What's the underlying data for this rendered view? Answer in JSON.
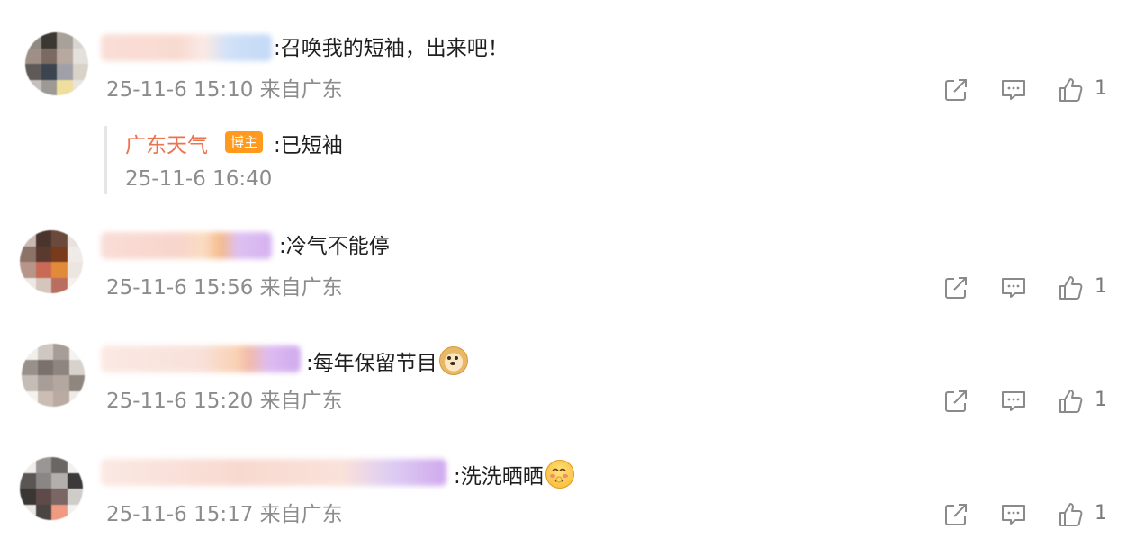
{
  "comments": [
    {
      "text": ":召唤我的短袖，出来吧！",
      "time": "25-11-6 15:10 来自广东",
      "likes": "1",
      "reply": {
        "author": "广东天气",
        "badge": "博主",
        "text": ":已短袖",
        "time": "25-11-6 16:40"
      }
    },
    {
      "text": ":冷气不能停",
      "time": "25-11-6 15:56 来自广东",
      "likes": "1"
    },
    {
      "text": ":每年保留节目",
      "emoji": "doge-icon",
      "time": "25-11-6 15:20 来自广东",
      "likes": "1"
    },
    {
      "text": ":洗洗晒晒",
      "emoji": "shy-face-icon",
      "time": "25-11-6 15:17 来自广东",
      "likes": "1"
    }
  ],
  "icons": [
    "share-icon",
    "comment-icon",
    "like-icon"
  ],
  "colors": {
    "reply_author": "#eb7350",
    "badge": "#ff9a1f",
    "meta_text": "#8c8c8c"
  }
}
